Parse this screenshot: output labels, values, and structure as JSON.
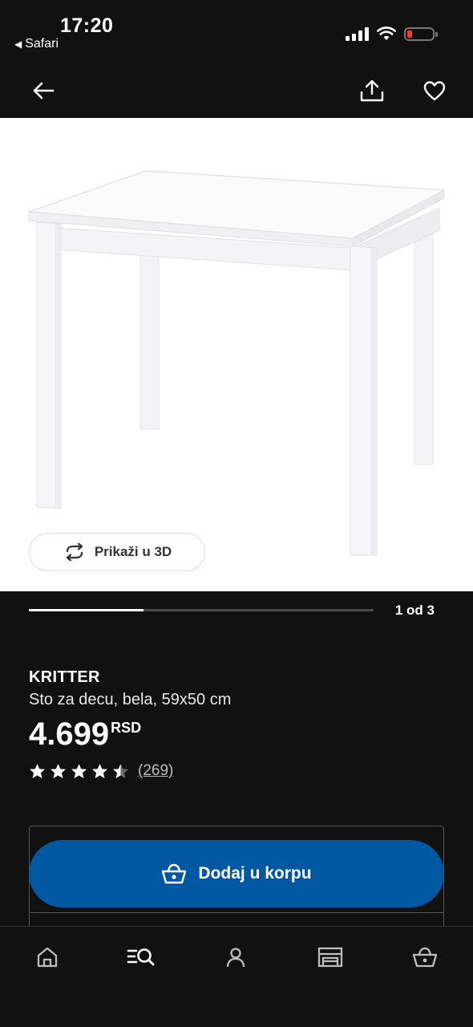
{
  "status_bar": {
    "time": "17:20",
    "back_app": "Safari",
    "battery_color": "#ff3b30"
  },
  "navbar": {
    "icons": [
      "arrow-left-icon",
      "share-icon",
      "heart-icon"
    ]
  },
  "gallery": {
    "view_3d_label": "Prikaži u 3D",
    "view_3d_icon": "rotate-icon",
    "page_indicator": "1 od 3",
    "progress_fraction": 0.333
  },
  "product": {
    "name": "KRITTER",
    "description": "Sto za decu, bela, 59x50 cm",
    "price": "4.699",
    "currency": "RSD",
    "rating_value": 4.5,
    "rating_max": 5,
    "review_count": "(269)"
  },
  "cart": {
    "add_label": "Dodaj u korpu",
    "add_icon": "basket-icon",
    "button_color": "#0058a3"
  },
  "bottom_nav": {
    "tabs": [
      "home-icon",
      "search-list-icon",
      "user-icon",
      "store-icon",
      "basket-icon"
    ]
  }
}
